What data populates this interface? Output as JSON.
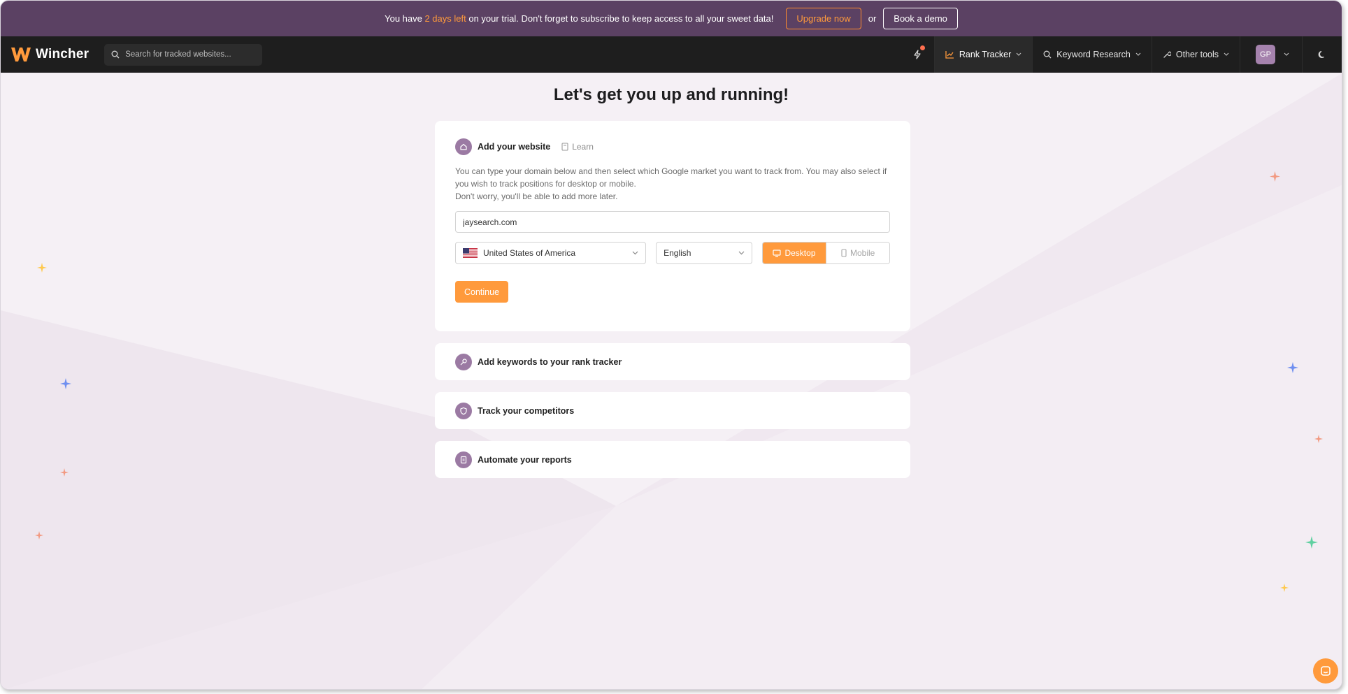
{
  "promo": {
    "text_before": "You have ",
    "highlight": "2 days left",
    "text_after": " on your trial. Don't forget to subscribe to keep access to all your sweet data!",
    "upgrade_label": "Upgrade now",
    "or_label": "or",
    "demo_label": "Book a demo"
  },
  "nav": {
    "logo_text": "Wincher",
    "search_placeholder": "Search for tracked websites...",
    "items": [
      {
        "label": "Rank Tracker",
        "icon": "chart-line-icon"
      },
      {
        "label": "Keyword Research",
        "icon": "search-icon"
      },
      {
        "label": "Other tools",
        "icon": "wrench-icon"
      }
    ],
    "avatar_initials": "GP"
  },
  "page": {
    "title": "Let's get you up and running!"
  },
  "setup": {
    "step_title": "Add your website",
    "learn_label": "Learn",
    "desc_line1": "You can type your domain below and then select which Google market you want to track from. You may also select if you wish to track positions for desktop or mobile.",
    "desc_line2": "Don't worry, you'll be able to add more later.",
    "domain_value": "jaysearch.com",
    "country": "United States of America",
    "language": "English",
    "device_desktop": "Desktop",
    "device_mobile": "Mobile",
    "continue_label": "Continue"
  },
  "steps": [
    {
      "title": "Add keywords to your rank tracker",
      "icon": "key-icon"
    },
    {
      "title": "Track your competitors",
      "icon": "shield-icon"
    },
    {
      "title": "Automate your reports",
      "icon": "document-icon"
    }
  ],
  "colors": {
    "accent": "#ff9a3c",
    "promo_bg": "#5b4163",
    "nav_bg": "#1e1e1e",
    "step_icon": "#9b7aa3",
    "page_bg": "#f5f0f5"
  }
}
